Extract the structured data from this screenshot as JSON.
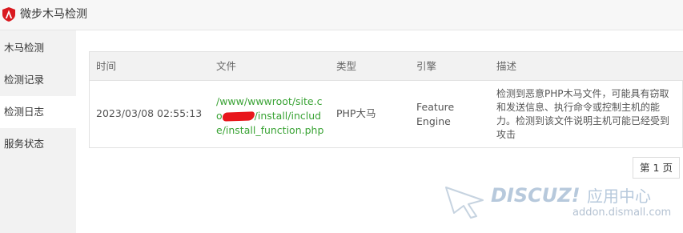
{
  "app": {
    "title": "微步木马检测",
    "logo_icon": "shield-logo-icon",
    "accent_color": "#d9191f"
  },
  "sidebar": {
    "items": [
      {
        "label": "木马检测",
        "active": false
      },
      {
        "label": "检测记录",
        "active": false
      },
      {
        "label": "检测日志",
        "active": true
      },
      {
        "label": "服务状态",
        "active": false
      }
    ]
  },
  "table": {
    "columns": [
      "时间",
      "文件",
      "类型",
      "引擎",
      "描述"
    ],
    "rows": [
      {
        "time": "2023/03/08 02:55:13",
        "file_prefix": "/www/wwwroot/site.co",
        "file_suffix": "/install/include/install_function.php",
        "type": "PHP大马",
        "engine": "Feature Engine",
        "description": "检测到恶意PHP木马文件，可能具有窃取和发送信息、执行命令或控制主机的能力。检测到该文件说明主机可能已经受到攻击"
      }
    ],
    "file_color": "#3aa335"
  },
  "pagination": {
    "label": "第 1 页"
  },
  "watermark": {
    "brand": "DISCUZ!",
    "center": "应用中心",
    "domain": "addon.dismall.com"
  }
}
